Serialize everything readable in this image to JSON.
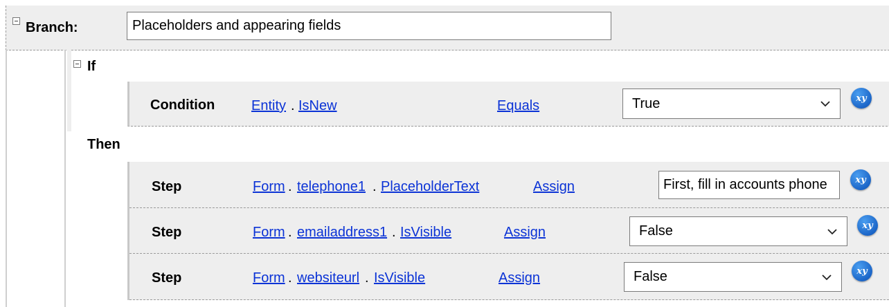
{
  "branch": {
    "label": "Branch:",
    "name_value": "Placeholders and appearing fields"
  },
  "if_block": {
    "label": "If",
    "condition": {
      "label": "Condition",
      "entity": "Entity",
      "field": "IsNew",
      "operator": "Equals",
      "value": "True"
    }
  },
  "then_block": {
    "label": "Then",
    "steps": [
      {
        "label": "Step",
        "path": [
          "Form",
          "telephone1",
          "PlaceholderText"
        ],
        "action": "Assign",
        "value": "First, fill in accounts phone"
      },
      {
        "label": "Step",
        "path": [
          "Form",
          "emailaddress1",
          "IsVisible"
        ],
        "action": "Assign",
        "value": "False"
      },
      {
        "label": "Step",
        "path": [
          "Form",
          "websiteurl",
          "IsVisible"
        ],
        "action": "Assign",
        "value": "False"
      }
    ]
  },
  "icons": {
    "toggle": "collapse-minus-icon",
    "variable": "xy-variable-icon",
    "dropdown": "chevron-down-icon"
  },
  "colors": {
    "link": "#0b33d6",
    "row_background": "#eeeeee",
    "variable_button": "#1c66c8"
  }
}
